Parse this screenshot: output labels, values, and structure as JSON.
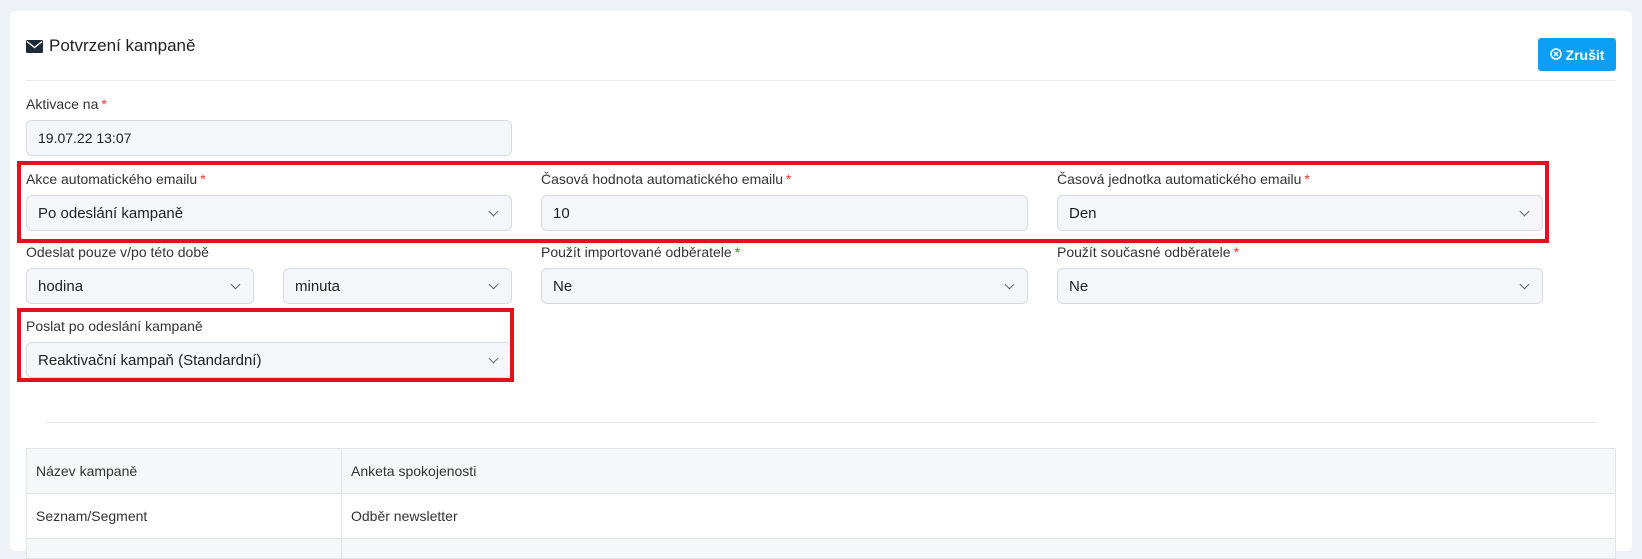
{
  "header": {
    "title": "Potvrzení kampaně",
    "cancel_label": "Zrušit"
  },
  "activation": {
    "label": "Aktivace na",
    "value": "19.07.22 13:07"
  },
  "auto_email_action": {
    "label": "Akce automatického emailu",
    "value": "Po odeslání kampaně"
  },
  "auto_email_time_value": {
    "label": "Časová hodnota automatického emailu",
    "value": "10"
  },
  "auto_email_time_unit": {
    "label": "Časová jednotka automatického emailu",
    "value": "Den"
  },
  "send_only_after": {
    "label": "Odeslat pouze v/po této době",
    "hour_value": "hodina",
    "minute_value": "minuta"
  },
  "use_imported": {
    "label": "Použít importované odběratele",
    "value": "Ne"
  },
  "use_current": {
    "label": "Použít současné odběratele",
    "value": "Ne"
  },
  "send_after_campaign": {
    "label": "Poslat po odeslání kampaně",
    "value": "Reaktivační kampaň (Standardní)"
  },
  "summary": {
    "rows": [
      {
        "key": "Název kampaně",
        "value": "Anketa spokojenosti"
      },
      {
        "key": "Seznam/Segment",
        "value": "Odběr newsletter"
      }
    ]
  },
  "colors": {
    "accent": "#0d9ef5",
    "highlight": "#e0121b",
    "required": "#e53935"
  },
  "icons": {
    "title_icon": "envelope-icon",
    "cancel_icon": "times-circle-icon"
  }
}
